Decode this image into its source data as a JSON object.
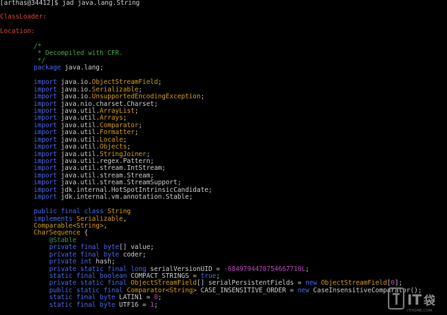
{
  "terminal": {
    "prompt": "[arthas@34412]$ jad java.lang.String",
    "classloader_label": "ClassLoader:",
    "location_label": "Location:"
  },
  "code": [
    [
      {
        "c": "cm",
        "t": "/*"
      }
    ],
    [
      {
        "c": "cm",
        "t": " * Decompiled with CFR."
      }
    ],
    [
      {
        "c": "cm",
        "t": " */"
      }
    ],
    [
      {
        "c": "kw",
        "t": "package "
      },
      {
        "c": "nm",
        "t": "java.lang;"
      }
    ],
    [],
    [
      {
        "c": "kw",
        "t": "import "
      },
      {
        "c": "nm",
        "t": "java.io."
      },
      {
        "c": "ty",
        "t": "ObjectStreamField"
      },
      {
        "c": "nm",
        "t": ";"
      }
    ],
    [
      {
        "c": "kw",
        "t": "import "
      },
      {
        "c": "nm",
        "t": "java.io."
      },
      {
        "c": "ty",
        "t": "Serializable"
      },
      {
        "c": "nm",
        "t": ";"
      }
    ],
    [
      {
        "c": "kw",
        "t": "import "
      },
      {
        "c": "nm",
        "t": "java.io."
      },
      {
        "c": "ty",
        "t": "UnsupportedEncodingException"
      },
      {
        "c": "nm",
        "t": ";"
      }
    ],
    [
      {
        "c": "kw",
        "t": "import "
      },
      {
        "c": "nm",
        "t": "java.nio.charset.Charset;"
      }
    ],
    [
      {
        "c": "kw",
        "t": "import "
      },
      {
        "c": "nm",
        "t": "java.util."
      },
      {
        "c": "ty",
        "t": "ArrayList"
      },
      {
        "c": "nm",
        "t": ";"
      }
    ],
    [
      {
        "c": "kw",
        "t": "import "
      },
      {
        "c": "nm",
        "t": "java.util."
      },
      {
        "c": "ty",
        "t": "Arrays"
      },
      {
        "c": "nm",
        "t": ";"
      }
    ],
    [
      {
        "c": "kw",
        "t": "import "
      },
      {
        "c": "nm",
        "t": "java.util."
      },
      {
        "c": "ty",
        "t": "Comparator"
      },
      {
        "c": "nm",
        "t": ";"
      }
    ],
    [
      {
        "c": "kw",
        "t": "import "
      },
      {
        "c": "nm",
        "t": "java.util."
      },
      {
        "c": "ty",
        "t": "Formatter"
      },
      {
        "c": "nm",
        "t": ";"
      }
    ],
    [
      {
        "c": "kw",
        "t": "import "
      },
      {
        "c": "nm",
        "t": "java.util."
      },
      {
        "c": "ty",
        "t": "Locale"
      },
      {
        "c": "nm",
        "t": ";"
      }
    ],
    [
      {
        "c": "kw",
        "t": "import "
      },
      {
        "c": "nm",
        "t": "java.util."
      },
      {
        "c": "ty",
        "t": "Objects"
      },
      {
        "c": "nm",
        "t": ";"
      }
    ],
    [
      {
        "c": "kw",
        "t": "import "
      },
      {
        "c": "nm",
        "t": "java.util."
      },
      {
        "c": "ty",
        "t": "StringJoiner"
      },
      {
        "c": "nm",
        "t": ";"
      }
    ],
    [
      {
        "c": "kw",
        "t": "import "
      },
      {
        "c": "nm",
        "t": "java.util.regex.Pattern;"
      }
    ],
    [
      {
        "c": "kw",
        "t": "import "
      },
      {
        "c": "nm",
        "t": "java.util.stream.IntStream;"
      }
    ],
    [
      {
        "c": "kw",
        "t": "import "
      },
      {
        "c": "nm",
        "t": "java.util.stream.Stream;"
      }
    ],
    [
      {
        "c": "kw",
        "t": "import "
      },
      {
        "c": "nm",
        "t": "java.util.stream.StreamSupport;"
      }
    ],
    [
      {
        "c": "kw",
        "t": "import "
      },
      {
        "c": "nm",
        "t": "jdk.internal.HotSpotIntrinsicCandidate;"
      }
    ],
    [
      {
        "c": "kw",
        "t": "import "
      },
      {
        "c": "nm",
        "t": "jdk.internal.vm.annotation.Stable;"
      }
    ],
    [],
    [
      {
        "c": "kw",
        "t": "public final class "
      },
      {
        "c": "ty",
        "t": "String"
      }
    ],
    [
      {
        "c": "kw",
        "t": "implements "
      },
      {
        "c": "ty",
        "t": "Serializable"
      },
      {
        "c": "nm",
        "t": ","
      }
    ],
    [
      {
        "c": "ty",
        "t": "Comparable<String>"
      },
      {
        "c": "nm",
        "t": ","
      }
    ],
    [
      {
        "c": "ty",
        "t": "CharSequence"
      },
      {
        "c": "nm",
        "t": " {"
      }
    ],
    [
      {
        "c": "an",
        "t": "    @Stable"
      }
    ],
    [
      {
        "c": "kw",
        "t": "    private final byte"
      },
      {
        "c": "nm",
        "t": "[] value;"
      }
    ],
    [
      {
        "c": "kw",
        "t": "    private final byte"
      },
      {
        "c": "nm",
        "t": " coder;"
      }
    ],
    [
      {
        "c": "kw",
        "t": "    private int"
      },
      {
        "c": "nm",
        "t": " hash;"
      }
    ],
    [
      {
        "c": "kw",
        "t": "    private static final long"
      },
      {
        "c": "nm",
        "t": " serialVersionUID = "
      },
      {
        "c": "num",
        "t": "-6849794470754667710L"
      },
      {
        "c": "nm",
        "t": ";"
      }
    ],
    [
      {
        "c": "kw",
        "t": "    static final boolean"
      },
      {
        "c": "nm",
        "t": " COMPACT_STRINGS = "
      },
      {
        "c": "kw",
        "t": "true"
      },
      {
        "c": "nm",
        "t": ";"
      }
    ],
    [
      {
        "c": "kw",
        "t": "    private static final "
      },
      {
        "c": "ty",
        "t": "ObjectStreamField"
      },
      {
        "c": "nm",
        "t": "[] serialPersistentFields = "
      },
      {
        "c": "kw",
        "t": "new "
      },
      {
        "c": "ty",
        "t": "ObjectStreamField"
      },
      {
        "c": "nm",
        "t": "["
      },
      {
        "c": "num",
        "t": "0"
      },
      {
        "c": "nm",
        "t": "];"
      }
    ],
    [
      {
        "c": "kw",
        "t": "    public static final "
      },
      {
        "c": "ty",
        "t": "Comparator<String>"
      },
      {
        "c": "nm",
        "t": " CASE_INSENSITIVE_ORDER = "
      },
      {
        "c": "kw",
        "t": "new "
      },
      {
        "c": "nm",
        "t": "CaseInsensitiveComparator();"
      }
    ],
    [
      {
        "c": "kw",
        "t": "    static final byte"
      },
      {
        "c": "nm",
        "t": " LATIN1 = "
      },
      {
        "c": "num",
        "t": "0"
      },
      {
        "c": "nm",
        "t": ";"
      }
    ],
    [
      {
        "c": "kw",
        "t": "    static final byte"
      },
      {
        "c": "nm",
        "t": " UTF16 = "
      },
      {
        "c": "num",
        "t": "1"
      },
      {
        "c": "nm",
        "t": ";"
      }
    ]
  ],
  "watermark": {
    "text": "IT",
    "subtext": "ITHOME.COM"
  },
  "colors": {
    "background": "#000000",
    "comment": "#4aa84a",
    "keyword": "#4a6cf0",
    "type": "#d7a10a",
    "error_label": "#e0463e",
    "number": "#c445c4"
  }
}
